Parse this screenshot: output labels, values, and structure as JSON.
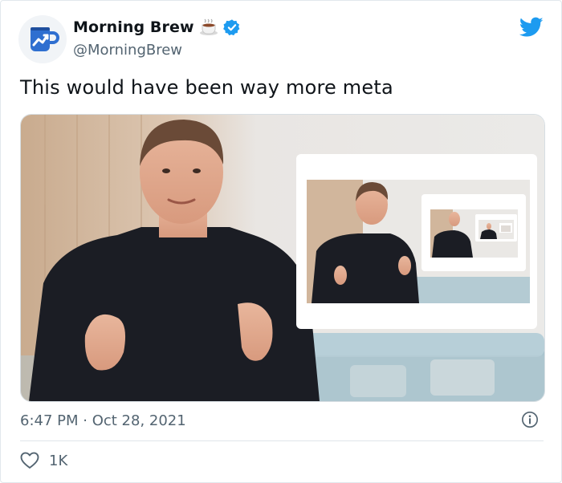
{
  "author": {
    "name": "Morning Brew",
    "handle": "@MorningBrew",
    "verified": true
  },
  "tweet": {
    "text": "This would have been way more meta",
    "timestamp": "6:47 PM · Oct 28, 2021"
  },
  "engagement": {
    "likes": "1K"
  },
  "colors": {
    "brand_blue": "#1d9bf0",
    "avatar_mug": "#2f6fd0",
    "muted_text": "#536471"
  },
  "icons": {
    "logo": "twitter-bird-icon",
    "verified": "verified-badge-icon",
    "coffee": "coffee-cup-emoji-icon",
    "info": "info-icon",
    "like": "heart-icon"
  }
}
